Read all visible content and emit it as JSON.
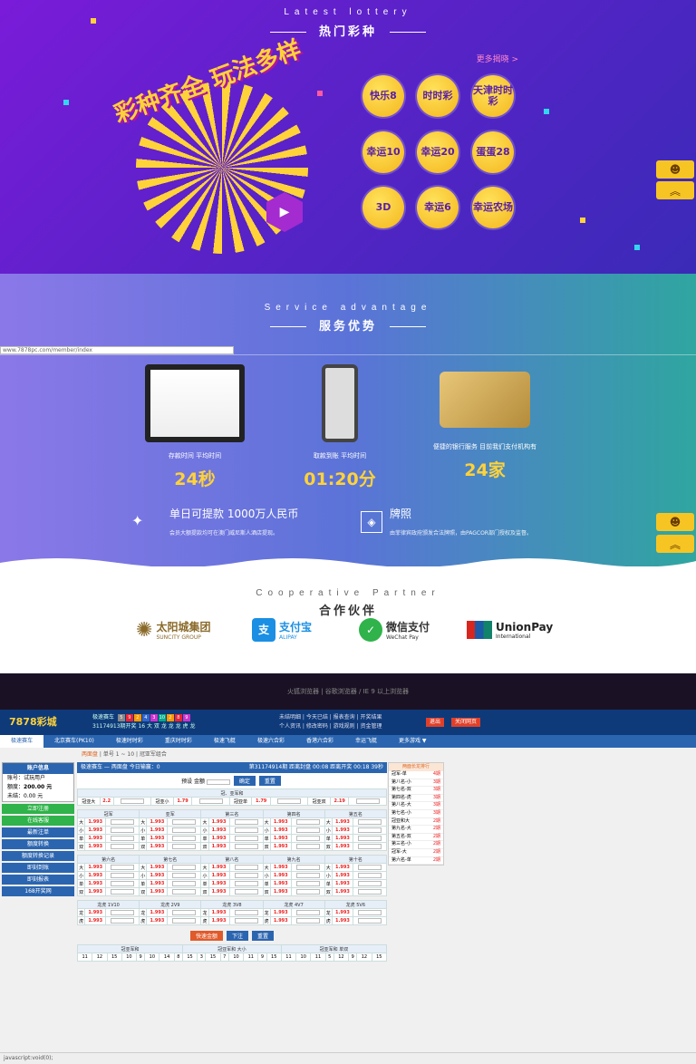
{
  "lottery": {
    "en_title": "Latest lottery",
    "cn_title": "热门彩种",
    "more": "更多揭晓 >",
    "promo": "彩种齐全 玩法多样",
    "balls": [
      "快乐8",
      "时时彩",
      "天津时时彩",
      "幸运10",
      "幸运20",
      "蛋蛋28",
      "3D",
      "幸运6",
      "幸运农场"
    ]
  },
  "service": {
    "url": "www.7878pc.com/member/index",
    "en_title": "Service advantage",
    "cn_title": "服务优势",
    "items": [
      {
        "label": "存款时间 平均时间",
        "value": "24秒"
      },
      {
        "label": "取款到账 平均时间",
        "value": "01:20分"
      },
      {
        "label": "便捷的银行服务 目前我们支付机构有",
        "value": "24家"
      }
    ],
    "lic1_title": "单日可提款 1000万人民币",
    "lic1_sub": "会员大额提款均可在澳门威尼斯人酒店提现。",
    "lic2_title": "牌照",
    "lic2_sub": "由菲律宾政府颁发合法牌照，由PAGCOR部门授权及监督。"
  },
  "partners": {
    "en_title": "Cooperative Partner",
    "cn_title": "合作伙伴",
    "items": [
      "太阳城集团",
      "支付宝",
      "微信支付",
      "UnionPay"
    ],
    "subs": [
      "SUNCITY GROUP",
      "ALIPAY",
      "WeChat Pay",
      "International"
    ]
  },
  "app": {
    "browser_tip": "火狐浏览器 | 谷歌浏览器 / IE 9 以上浏览器",
    "logo": "7878彩城",
    "draw_label": "极速赛车",
    "draw_period": "31174913期开奖",
    "draw_nums": [
      "5",
      "9",
      "2",
      "4",
      "3",
      "10",
      "2",
      "8",
      "9"
    ],
    "draw_tail": "16 大 双 龙 龙 龙 虎 龙",
    "links": [
      "未结明细 | 今天已结 | 报表查询 | 开奖结果",
      "个人资讯 | 修改密码 | 游戏规则 | 资金管理"
    ],
    "hdr_btns": [
      "退出",
      "关闭网页"
    ],
    "nav": [
      "极速赛车",
      "北京赛车(PK10)",
      "极速时时彩",
      "重庆时时彩",
      "极速飞艇",
      "极速六合彩",
      "香港六合彩",
      "幸运飞艇",
      "更多游戏 ▼"
    ],
    "crumb_home": "两面盘",
    "crumb_rest": " | 单号 1 ~ 10 | 冠亚军组合",
    "acct": {
      "title": "账户信息",
      "user": "账号：试玩用户",
      "credit_label": "额度：",
      "credit": "200.00 元",
      "unsettled": "未结：0.00 元"
    },
    "left_btns": [
      "立即注册",
      "在线客服",
      "最新注单",
      "额度转换",
      "额度转换记录",
      "即刻到账",
      "即刻报表",
      "168开奖网"
    ],
    "bar_left": "极速赛车 — 两面盘  今日输赢：0",
    "bar_right": "第31174914期 距离封盘 00:08 距离开奖 00:18 39秒",
    "quick": "预设  金额",
    "quick_btns": [
      "确定",
      "重置"
    ],
    "sec1": "冠、亚军和",
    "gy": [
      [
        "冠亚大",
        "2.2"
      ],
      [
        "冠亚小",
        "1.79"
      ],
      [
        "冠亚单",
        "1.79"
      ],
      [
        "冠亚双",
        "2.19"
      ]
    ],
    "pos1": [
      "冠军",
      "亚军",
      "第三名",
      "第四名",
      "第五名"
    ],
    "pos2": [
      "第六名",
      "第七名",
      "第八名",
      "第九名",
      "第十名"
    ],
    "dx": [
      "大",
      "小",
      "单",
      "双"
    ],
    "odd": "1.993",
    "lh": [
      "龙虎 1V10",
      "龙虎 2V9",
      "龙虎 3V8",
      "龙虎 4V7",
      "龙虎 5V6"
    ],
    "lhr": [
      "龙",
      "虎"
    ],
    "btns": [
      "快速金额",
      "下注",
      "重置"
    ],
    "hist_heads": [
      "冠亚军和",
      "冠亚军和 大小",
      "冠亚军和 单双"
    ],
    "hist": [
      "11",
      "12",
      "15",
      "10",
      "9",
      "10",
      "14",
      "8",
      "15",
      "3",
      "15",
      "7",
      "10",
      "11",
      "9",
      "15",
      "11",
      "10",
      "11",
      "5",
      "12",
      "9",
      "12",
      "15"
    ],
    "stats_title": "两面长龙排行",
    "stats": [
      [
        "冠军-单",
        "4期"
      ],
      [
        "第八名-小",
        "3期"
      ],
      [
        "第七名-双",
        "3期"
      ],
      [
        "第四名-虎",
        "3期"
      ],
      [
        "第八名-大",
        "3期"
      ],
      [
        "第七名-小",
        "3期"
      ],
      [
        "冠亚和大",
        "2期"
      ],
      [
        "第九名-大",
        "2期"
      ],
      [
        "第五名-双",
        "2期"
      ],
      [
        "第三名-小",
        "2期"
      ],
      [
        "冠军-大",
        "2期"
      ],
      [
        "第六名-单",
        "2期"
      ]
    ],
    "status": "javascript:void(0);"
  }
}
